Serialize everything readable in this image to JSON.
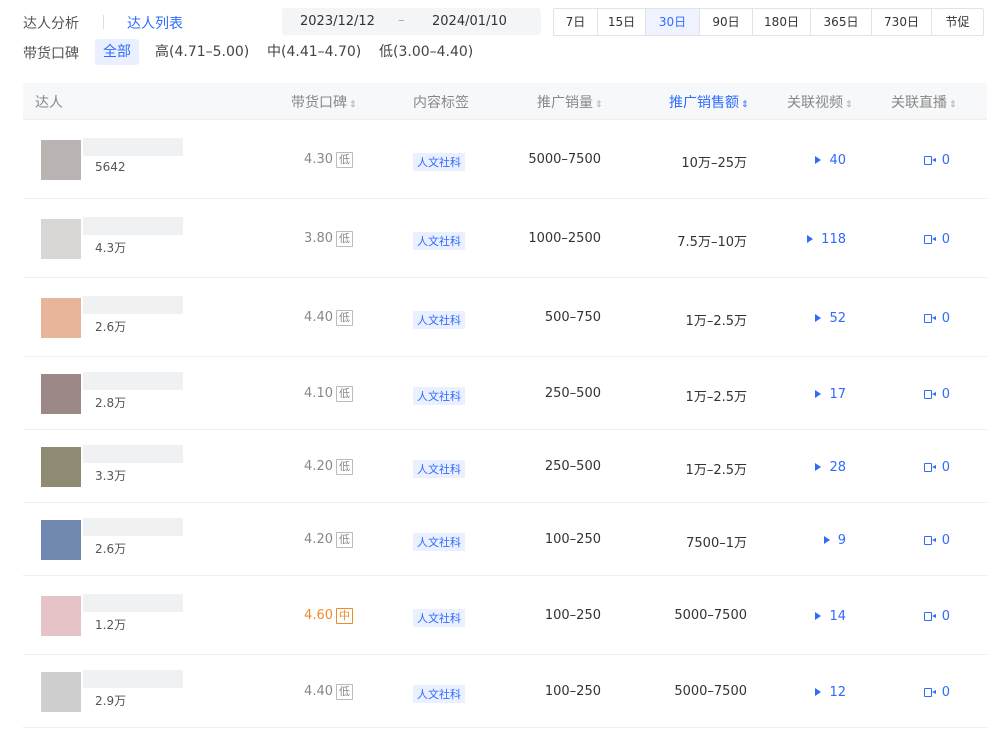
{
  "tabs": {
    "analysis": "达人分析",
    "list": "达人列表"
  },
  "date_range": {
    "start": "2023/12/12",
    "separator": "–",
    "end": "2024/01/10"
  },
  "periods": [
    {
      "label": "7日",
      "active": false
    },
    {
      "label": "15日",
      "active": false
    },
    {
      "label": "30日",
      "active": true
    },
    {
      "label": "90日",
      "active": false
    },
    {
      "label": "180日",
      "active": false
    },
    {
      "label": "365日",
      "active": false
    },
    {
      "label": "730日",
      "active": false
    },
    {
      "label": "节促",
      "active": false
    }
  ],
  "filter": {
    "label": "带货口碑",
    "all": "全部",
    "high": "高(4.71–5.00)",
    "mid": "中(4.41–4.70)",
    "low": "低(3.00–4.40)"
  },
  "columns": {
    "influencer": "达人",
    "reputation": "带货口碑",
    "tag": "内容标签",
    "volume": "推广销量",
    "amount": "推广销售额",
    "videos": "关联视频",
    "lives": "关联直播"
  },
  "rows": [
    {
      "fans": "5642",
      "score": "4.30",
      "level": "低",
      "tag": "人文社科",
      "volume": "5000–7500",
      "amount": "10万–25万",
      "videos": "40",
      "lives": "0",
      "avatar_color": "#b9b4b1"
    },
    {
      "fans": "4.3万",
      "score": "3.80",
      "level": "低",
      "tag": "人文社科",
      "volume": "1000–2500",
      "amount": "7.5万–10万",
      "videos": "118",
      "lives": "0",
      "avatar_color": "#d9d7d6"
    },
    {
      "fans": "2.6万",
      "score": "4.40",
      "level": "低",
      "tag": "人文社科",
      "volume": "500–750",
      "amount": "1万–2.5万",
      "videos": "52",
      "lives": "0",
      "avatar_color": "#e6b59a"
    },
    {
      "fans": "2.8万",
      "score": "4.10",
      "level": "低",
      "tag": "人文社科",
      "volume": "250–500",
      "amount": "1万–2.5万",
      "videos": "17",
      "lives": "0",
      "avatar_color": "#9c8987"
    },
    {
      "fans": "3.3万",
      "score": "4.20",
      "level": "低",
      "tag": "人文社科",
      "volume": "250–500",
      "amount": "1万–2.5万",
      "videos": "28",
      "lives": "0",
      "avatar_color": "#8f8a72"
    },
    {
      "fans": "2.6万",
      "score": "4.20",
      "level": "低",
      "tag": "人文社科",
      "volume": "100–250",
      "amount": "7500–1万",
      "videos": "9",
      "lives": "0",
      "avatar_color": "#7088b0"
    },
    {
      "fans": "1.2万",
      "score": "4.60",
      "level": "中",
      "tag": "人文社科",
      "volume": "100–250",
      "amount": "5000–7500",
      "videos": "14",
      "lives": "0",
      "avatar_color": "#e6c3c6"
    },
    {
      "fans": "2.9万",
      "score": "4.40",
      "level": "低",
      "tag": "人文社科",
      "volume": "100–250",
      "amount": "5000–7500",
      "videos": "12",
      "lives": "0",
      "avatar_color": "#cfcfcf"
    }
  ]
}
